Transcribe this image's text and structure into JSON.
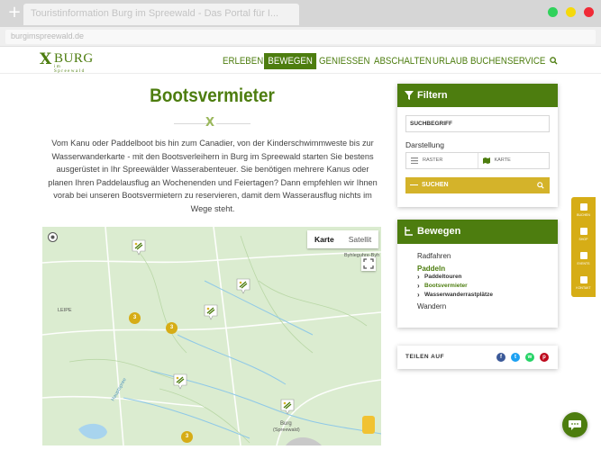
{
  "browser": {
    "tab_title": "Touristinformation Burg im Spreewald - Das Portal für I...",
    "url": "burgimspreewald.de"
  },
  "logo": {
    "mark": "X",
    "name": "BURG",
    "subtitle": "im Spreewald"
  },
  "nav": {
    "items": [
      "ERLEBEN",
      "BEWEGEN",
      "GENIESSEN",
      "ABSCHALTEN",
      "URLAUB BUCHEN",
      "SERVICE"
    ],
    "active": "BEWEGEN"
  },
  "main": {
    "title": "Bootsvermieter",
    "divider_mark": "X",
    "intro": "Vom Kanu oder Paddelboot bis hin zum Canadier, von der Kinderschwimmweste bis zur Wasserwanderkarte - mit den Bootsverleihern in Burg im Spreewald starten Sie bestens ausgerüstet in Ihr Spreewälder Wasserabenteuer. Sie benötigen mehrere Kanus oder planen Ihren Paddelausflug an Wochenenden und Feiertagen? Dann empfehlen wir Ihnen vorab bei unseren Bootsvermietern zu reservieren, damit dem Wasserausflug nichts im Wege steht."
  },
  "map": {
    "type_karte": "Karte",
    "type_satellit": "Satellit",
    "labels": {
      "leipe": "LEIPE",
      "byhleguhre": "Byhleguhre-Byh",
      "burg": "Burg",
      "burg_sub": "(Spreewald)",
      "hauptspree": "Hauptspree"
    },
    "clusters": [
      "3",
      "3",
      "3"
    ]
  },
  "filter": {
    "heading": "Filtern",
    "search_placeholder": "SUCHBEGRIFF",
    "display_label": "Darstellung",
    "view_raster": "RASTER",
    "view_karte": "KARTE",
    "submit": "SUCHEN"
  },
  "bewegen_panel": {
    "heading": "Bewegen",
    "radfahren": "Radfahren",
    "paddeln": "Paddeln",
    "paddeltouren": "Paddeltouren",
    "bootsvermieter": "Bootsvermieter",
    "wasserwanderrastplaetze": "Wasserwanderrastplätze",
    "wandern": "Wandern"
  },
  "share": {
    "label": "TEILEN AUF",
    "networks": [
      "facebook-icon",
      "twitter-icon",
      "whatsapp-icon",
      "pinterest-icon"
    ],
    "colors": {
      "facebook": "#3b5998",
      "twitter": "#1da1f2",
      "whatsapp": "#25d366",
      "pinterest": "#bd081c"
    }
  },
  "side_tabs": {
    "items": [
      "BUCHEN",
      "SHOP",
      "EVENTS",
      "KONTAKT"
    ]
  },
  "colors": {
    "brand_green": "#4d7d0f",
    "accent_gold": "#d4b32a"
  }
}
